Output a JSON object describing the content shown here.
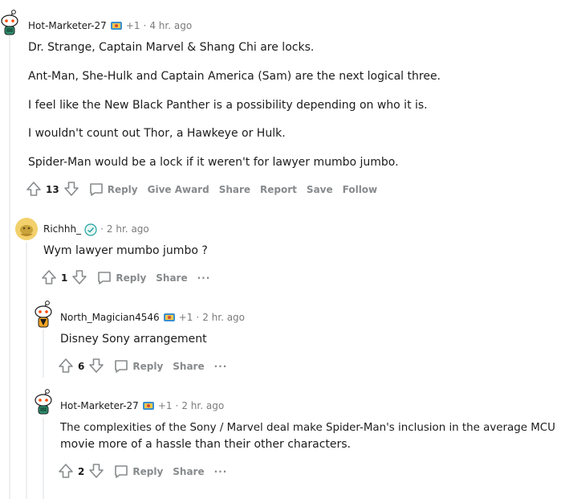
{
  "comments": [
    {
      "username": "Hot-Marketer-27",
      "plus": "+1",
      "separator": "·",
      "time": "4 hr. ago",
      "paragraphs": [
        "Dr. Strange, Captain Marvel & Shang Chi are locks.",
        "Ant-Man, She-Hulk and Captain America (Sam) are the next logical three.",
        "I feel like the New Black Panther is a possibility depending on who it is.",
        "I wouldn't count out Thor, a Hawkeye or Hulk.",
        "Spider-Man would be a lock if it weren't for lawyer mumbo jumbo."
      ],
      "votes": "13",
      "actions": [
        "Reply",
        "Give Award",
        "Share",
        "Report",
        "Save",
        "Follow"
      ]
    },
    {
      "username": "Richhh_",
      "separator": "·",
      "time": "2 hr. ago",
      "paragraphs": [
        "Wym lawyer mumbo jumbo ?"
      ],
      "votes": "1",
      "actions": [
        "Reply",
        "Share"
      ],
      "more": "···"
    },
    {
      "username": "North_Magician4546",
      "plus": "+1",
      "separator": "·",
      "time": "2 hr. ago",
      "paragraphs": [
        "Disney Sony arrangement"
      ],
      "votes": "6",
      "actions": [
        "Reply",
        "Share"
      ],
      "more": "···"
    },
    {
      "username": "Hot-Marketer-27",
      "plus": "+1",
      "separator": "·",
      "time": "2 hr. ago",
      "paragraphs": [
        "The complexities of the Sony / Marvel deal make Spider-Man's inclusion in the average MCU",
        "movie more of a hassle than their other characters."
      ],
      "votes": "2",
      "actions": [
        "Reply",
        "Share"
      ],
      "more": "···"
    }
  ]
}
